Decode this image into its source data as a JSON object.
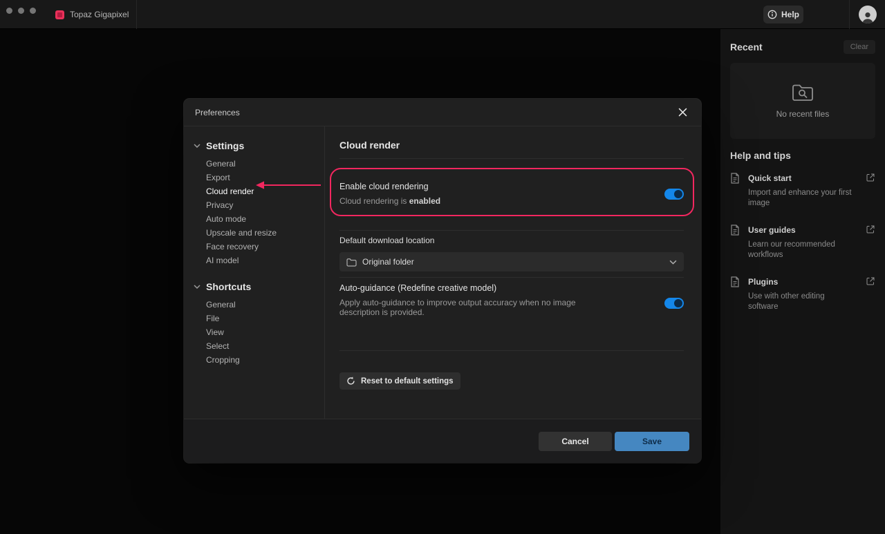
{
  "titlebar": {
    "app_name": "Topaz Gigapixel",
    "help_label": "Help"
  },
  "right_panel": {
    "recent_title": "Recent",
    "clear_label": "Clear",
    "empty_text": "No recent files",
    "help_tips_title": "Help and tips",
    "tips": [
      {
        "title": "Quick start",
        "desc": "Import and enhance your first image"
      },
      {
        "title": "User guides",
        "desc": "Learn our recommended workflows"
      },
      {
        "title": "Plugins",
        "desc": "Use with other editing software"
      }
    ]
  },
  "modal": {
    "title": "Preferences",
    "nav": {
      "settings_label": "Settings",
      "settings_items": [
        "General",
        "Export",
        "Cloud render",
        "Privacy",
        "Auto mode",
        "Upscale and resize",
        "Face recovery",
        "AI model"
      ],
      "shortcuts_label": "Shortcuts",
      "shortcuts_items": [
        "General",
        "File",
        "View",
        "Select",
        "Cropping"
      ],
      "selected_item": "Cloud render"
    },
    "content": {
      "heading": "Cloud render",
      "enable": {
        "title": "Enable cloud rendering",
        "status_prefix": "Cloud rendering is ",
        "status_bold": "enabled",
        "toggle_state": "on"
      },
      "download": {
        "label": "Default download location",
        "value": "Original folder"
      },
      "autoguidance": {
        "title": "Auto-guidance (Redefine creative model)",
        "desc": "Apply auto-guidance to improve output accuracy when no image description is provided.",
        "toggle_state": "on"
      },
      "reset_label": "Reset to default settings"
    },
    "footer": {
      "cancel_label": "Cancel",
      "save_label": "Save"
    }
  },
  "colors": {
    "accent_toggle_blue": "#1487ea",
    "save_button_blue": "#4587c1",
    "annotation_pink": "#f2275f"
  }
}
